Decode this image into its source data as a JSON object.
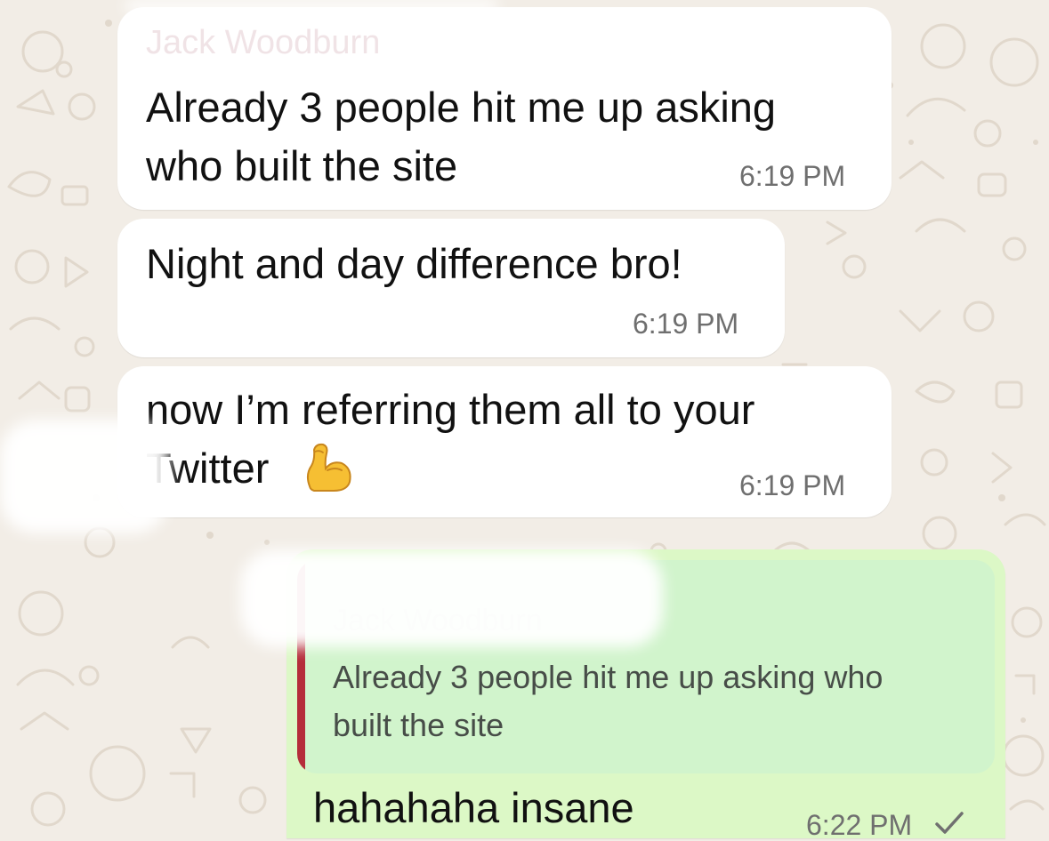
{
  "colors": {
    "wallpaper": "#f2ede6",
    "incoming_bubble": "#ffffff",
    "outgoing_bubble": "#dcf8c6",
    "quote_bar": "#b52d3a",
    "timestamp": "#6f6f6f"
  },
  "messages": [
    {
      "sender": "Jack Woodburn",
      "lines": [
        "Already 3 people hit me up asking",
        "who built the site"
      ],
      "time": "6:19 PM"
    },
    {
      "lines": [
        "Night and day difference bro!"
      ],
      "time": "6:19 PM"
    },
    {
      "lines": [
        "now I’m referring them all to your",
        "Twitter"
      ],
      "emoji": "flexed-biceps-icon",
      "time": "6:19 PM"
    }
  ],
  "reply": {
    "quoted_author": "Jack Woodburn",
    "quoted_lines": [
      "Already 3 people hit me up asking who",
      "built the site"
    ],
    "text": "hahahaha insane",
    "time": "6:22 PM",
    "status_icon": "sent-check-icon"
  }
}
